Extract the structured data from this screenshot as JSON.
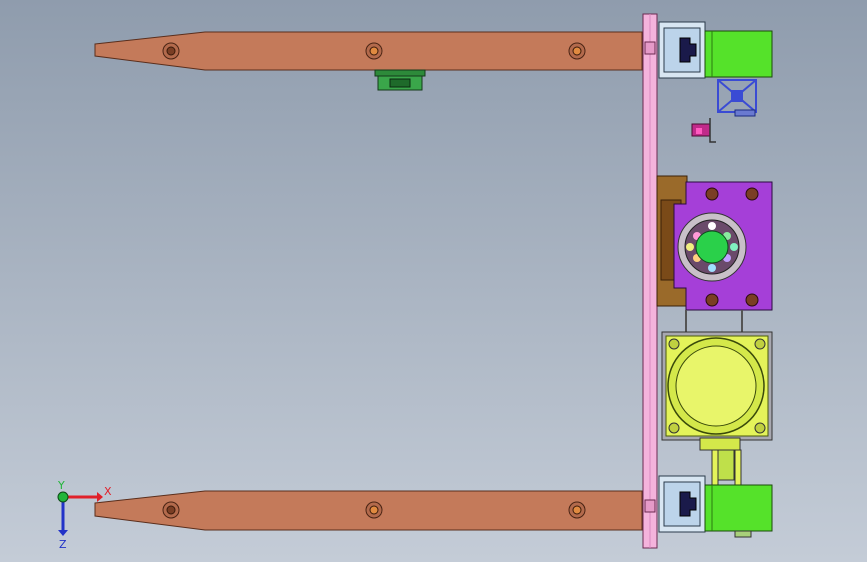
{
  "viewport": {
    "background_top": "#8f9cad",
    "background_bottom": "#c4ccd7"
  },
  "triad": {
    "x_label": "X",
    "y_label": "Y",
    "z_label": "Z",
    "x_color": "#e0202a",
    "y_color": "#22b53a",
    "z_color": "#2233c8"
  },
  "parts": {
    "fork_arm_color": "#c47a5a",
    "plate_color": "#f4b3dc",
    "block_color": "#d8e6f2",
    "cylinder_color": "#55e22a",
    "motor_color": "#e4f35a",
    "bearing_block_color": "#a53fd8",
    "bracket_color": "#9a6a2a",
    "profile_color": "#3a4bd4"
  }
}
